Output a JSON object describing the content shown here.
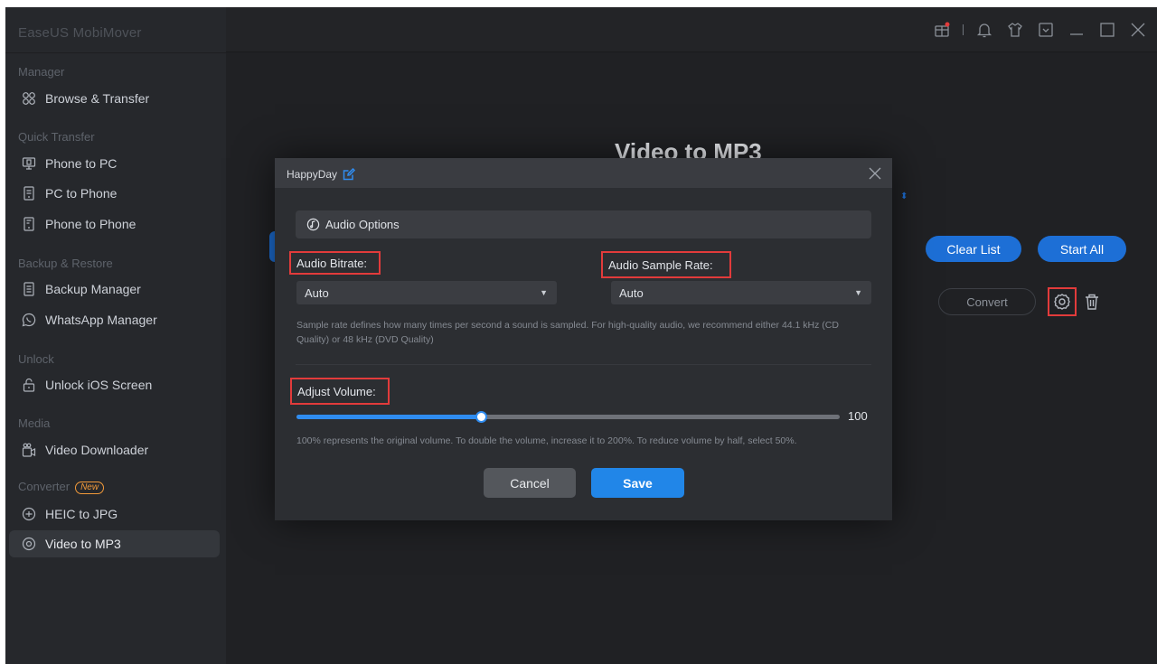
{
  "app": {
    "title": "EaseUS MobiMover"
  },
  "sidebar": {
    "sections": [
      {
        "title": "Manager",
        "items": [
          {
            "label": "Browse & Transfer",
            "icon": "grid-icon"
          }
        ]
      },
      {
        "title": "Quick Transfer",
        "items": [
          {
            "label": "Phone to PC",
            "icon": "phone-to-pc-icon"
          },
          {
            "label": "PC to Phone",
            "icon": "pc-to-phone-icon"
          },
          {
            "label": "Phone to Phone",
            "icon": "phone-to-phone-icon"
          }
        ]
      },
      {
        "title": "Backup & Restore",
        "items": [
          {
            "label": "Backup Manager",
            "icon": "backup-icon"
          },
          {
            "label": "WhatsApp Manager",
            "icon": "whatsapp-icon"
          }
        ]
      },
      {
        "title": "Unlock",
        "items": [
          {
            "label": "Unlock iOS Screen",
            "icon": "unlock-icon"
          }
        ]
      },
      {
        "title": "Media",
        "items": [
          {
            "label": "Video Downloader",
            "icon": "video-download-icon"
          }
        ]
      },
      {
        "title": "Converter",
        "badge": "New",
        "items": [
          {
            "label": "HEIC to JPG",
            "icon": "heic-icon"
          },
          {
            "label": "Video to MP3",
            "icon": "video-mp3-icon",
            "active": true
          }
        ]
      }
    ]
  },
  "main": {
    "page_title": "Video to MP3",
    "clear_list": "Clear List",
    "start_all": "Start All",
    "convert": "Convert"
  },
  "dialog": {
    "file_name": "HappyDay",
    "section_title": "Audio Options",
    "bitrate_label": "Audio Bitrate:",
    "bitrate_value": "Auto",
    "samplerate_label": "Audio Sample Rate:",
    "samplerate_value": "Auto",
    "samplerate_note": "Sample rate defines how many times per second a sound is sampled. For high-quality audio, we recommend either 44.1 kHz (CD Quality) or 48 kHz (DVD Quality)",
    "volume_label": "Adjust Volume:",
    "volume_value": "100",
    "volume_fraction": 0.34,
    "volume_note": "100% represents the original volume. To double the volume, increase it to 200%. To reduce volume by half, select 50%.",
    "cancel": "Cancel",
    "save": "Save"
  },
  "colors": {
    "accent": "#1d6fd6",
    "highlight": "#e23b3b",
    "badge": "#f29a3a"
  }
}
